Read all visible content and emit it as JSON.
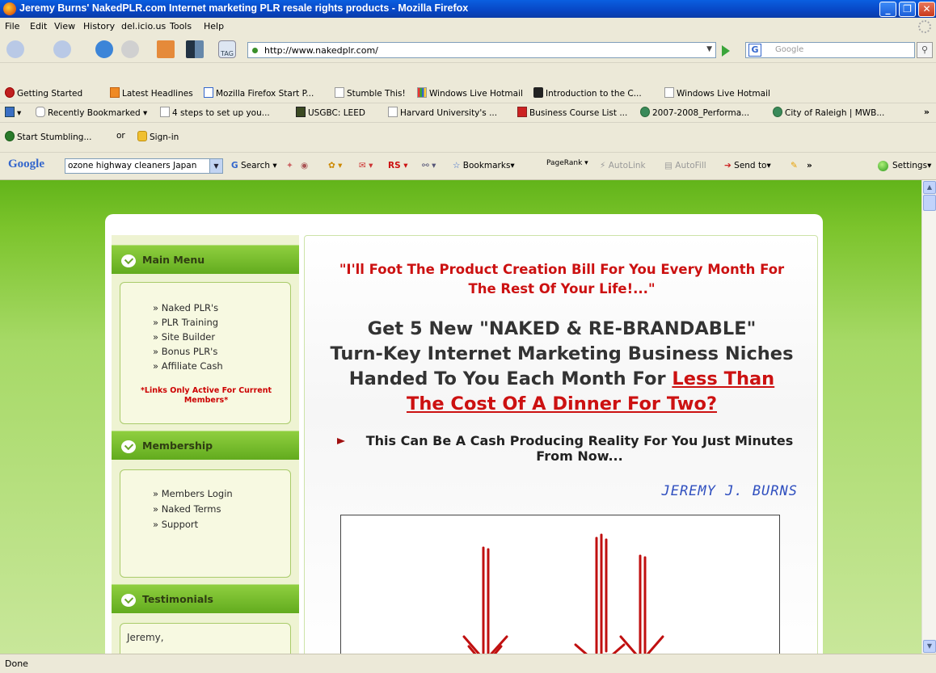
{
  "window": {
    "title": "Jeremy Burns' NakedPLR.com Internet marketing PLR resale rights products - Mozilla Firefox",
    "minimize": "_",
    "maximize": "❐",
    "close": "✕"
  },
  "menu": {
    "items": [
      "File",
      "Edit",
      "View",
      "History",
      "del.icio.us",
      "Tools",
      "Help"
    ]
  },
  "nav": {
    "url": "http://www.nakedplr.com/",
    "tag_label": "TAG",
    "search_engine_label": "G",
    "search_placeholder": "Google"
  },
  "bookmarks_row1": [
    "Getting Started",
    "Latest Headlines",
    "Mozilla Firefox Start P...",
    "Stumble This!",
    "Windows Live Hotmail",
    "Introduction to the C...",
    "Windows Live Hotmail"
  ],
  "bookmarks_row2": [
    "Recently Bookmarked ▾",
    "4 steps to set up you...",
    "USGBC: LEED",
    "Harvard University's ...",
    "Business Course List ...",
    "2007-2008_Performa...",
    "City of Raleigh | MWB..."
  ],
  "bookmarks_overflow": "»",
  "stumble": {
    "start": "Start Stumbling...",
    "or": "or",
    "signin": "Sign-in"
  },
  "google_toolbar": {
    "logo": "Google",
    "query": "ozone highway cleaners Japan",
    "search": "Search ▾",
    "rs": "RS ▾",
    "bookmarks": "Bookmarks▾",
    "pagerank": "PageRank ▾",
    "autolink": "AutoLink",
    "autofill": "AutoFill",
    "sendto": "Send to▾",
    "more": "»",
    "settings": "Settings▾"
  },
  "sidebar": {
    "main_menu_title": "Main Menu",
    "main_menu_links": [
      "Naked PLR's",
      "PLR Training",
      "Site Builder",
      "Bonus PLR's",
      "Affiliate Cash"
    ],
    "members_note": "*Links Only Active For Current Members*",
    "membership_title": "Membership",
    "membership_links": [
      "Members Login",
      "Naked Terms",
      "Support"
    ],
    "testimonials_title": "Testimonials",
    "testimonial_start": "Jeremy,"
  },
  "main": {
    "quote": "\"I'll Foot The Product Creation Bill For You Every Month For The Rest Of Your Life!...\"",
    "headline_1": "Get 5 New \"NAKED & RE-BRANDABLE\"",
    "headline_2": "Turn-Key Internet Marketing Business Niches",
    "headline_3": "Handed To You Each Month For",
    "headline_red_1": "Less Than",
    "headline_red_2": "The Cost Of A Dinner For Two?",
    "subhead": "This Can Be A Cash Producing Reality For You Just Minutes From Now...",
    "signature": "JEREMY J. BURNS"
  },
  "status": {
    "text": "Done"
  },
  "colors": {
    "accent_red": "#cc1111",
    "page_green": "#7cc42c",
    "signature_blue": "#2f4fbf"
  }
}
